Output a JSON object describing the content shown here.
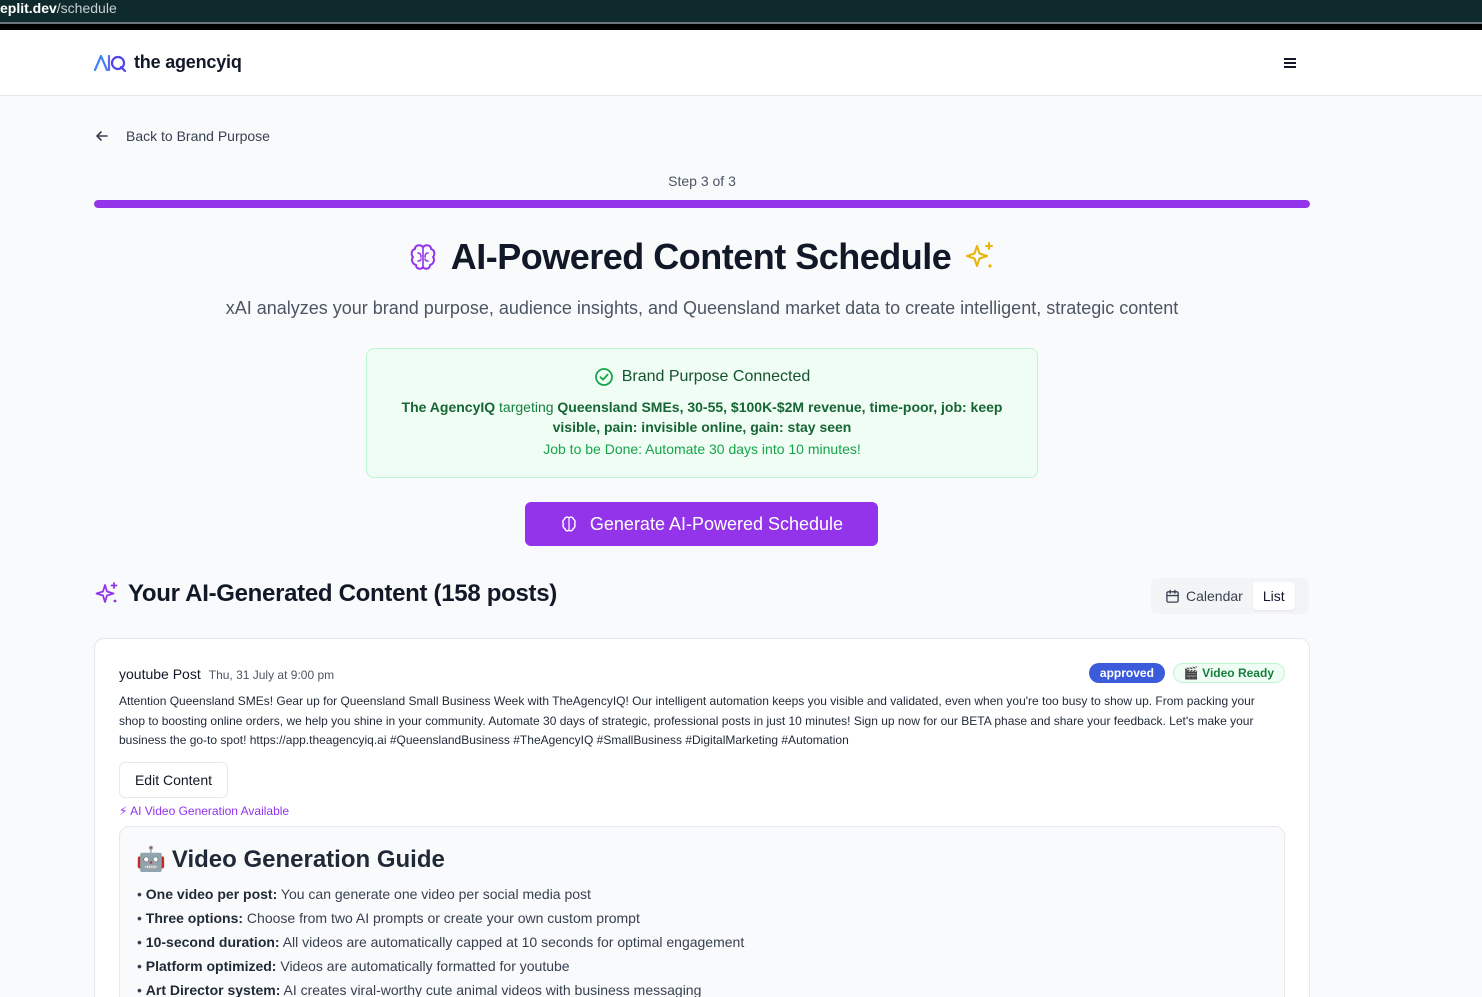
{
  "browser": {
    "url_host": "eplit.dev",
    "url_path": "/schedule"
  },
  "header": {
    "logo_text": "the agencyiq"
  },
  "nav": {
    "back_label": "Back to Brand Purpose"
  },
  "progress": {
    "step_label": "Step 3 of 3",
    "fraction": 1.0
  },
  "hero": {
    "title": "AI-Powered Content Schedule",
    "subtitle": "xAI analyzes your brand purpose, audience insights, and Queensland market data to create intelligent, strategic content"
  },
  "brand_card": {
    "heading": "Brand Purpose Connected",
    "brand_name": "The AgencyIQ",
    "targeting_word": "targeting",
    "audience": "Queensland SMEs, 30-55, $100K-$2M revenue, time-poor, job: keep visible, pain: invisible online, gain: stay seen",
    "jtbd": "Job to be Done: Automate 30 days into 10 minutes!"
  },
  "generate_button": {
    "label": "Generate AI-Powered Schedule"
  },
  "content_section": {
    "title": "Your AI-Generated Content (158 posts)",
    "view_options": {
      "calendar": "Calendar",
      "list": "List",
      "selected": "List"
    }
  },
  "post": {
    "type_label": "youtube Post",
    "date": "Thu, 31 July at 9:00 pm",
    "status_badge": "approved",
    "video_badge": "🎬 Video Ready",
    "content": "Attention Queensland SMEs! Gear up for Queensland Small Business Week with TheAgencyIQ! Our intelligent automation keeps you visible and validated, even when you're too busy to show up. From packing your shop to boosting online orders, we help you shine in your community. Automate 30 days of strategic, professional posts in just 10 minutes! Sign up now for our BETA phase and share your feedback. Let's make your business the go-to spot! https://app.theagencyiq.ai #QueenslandBusiness #TheAgencyIQ #SmallBusiness #DigitalMarketing #Automation",
    "edit_button": "Edit Content",
    "ai_video_note": "⚡ AI Video Generation Available"
  },
  "video_guide": {
    "emoji": "🤖",
    "title": "Video Generation Guide",
    "items": [
      {
        "label": "One video per post:",
        "text": "You can generate one video per social media post"
      },
      {
        "label": "Three options:",
        "text": "Choose from two AI prompts or create your own custom prompt"
      },
      {
        "label": "10-second duration:",
        "text": "All videos are automatically capped at 10 seconds for optimal engagement"
      },
      {
        "label": "Platform optimized:",
        "text": "Videos are automatically formatted for youtube"
      },
      {
        "label": "Art Director system:",
        "text": "AI creates viral-worthy cute animal videos with business messaging"
      }
    ]
  },
  "colors": {
    "accent": "#9333ea",
    "success": "#16a34a",
    "approved": "#3b5bdb"
  }
}
